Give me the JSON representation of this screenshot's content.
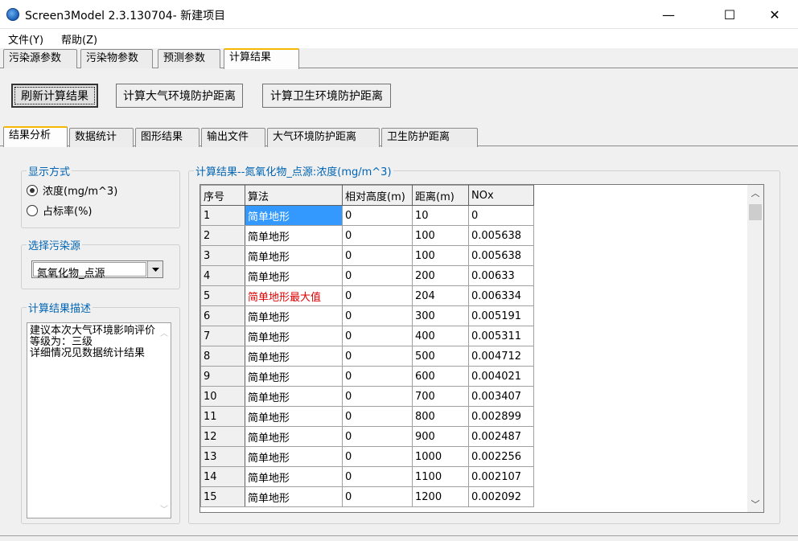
{
  "window": {
    "title": "Screen3Model 2.3.130704- 新建项目",
    "minimize": "—",
    "maximize": "☐",
    "close": "✕"
  },
  "menu": [
    "文件(Y)",
    "帮助(Z)"
  ],
  "main_tabs": [
    "污染源参数",
    "污染物参数",
    "预测参数",
    "计算结果"
  ],
  "main_tab_active": 3,
  "buttons": {
    "refresh": "刷新计算结果",
    "calc_air": "计算大气环境防护距离",
    "calc_health": "计算卫生环境防护距离"
  },
  "sub_tabs": [
    "结果分析",
    "数据统计",
    "图形结果",
    "输出文件",
    "大气环境防护距离",
    "卫生防护距离"
  ],
  "sub_tab_active": 0,
  "display_mode": {
    "label": "显示方式",
    "options": [
      "浓度(mg/m^3)",
      "占标率(%)"
    ],
    "selected": 0
  },
  "source_select": {
    "label": "选择污染源",
    "value": "氮氧化物_点源"
  },
  "description": {
    "label": "计算结果描述",
    "text": "建议本次大气环境影响评价等级为：三级\n详细情况见数据统计结果"
  },
  "results": {
    "label": "计算结果--氮氧化物_点源:浓度(mg/m^3)",
    "columns": [
      "序号",
      "算法",
      "相对高度(m)",
      "距离(m)",
      "NOx"
    ],
    "rows": [
      [
        "1",
        "简单地形",
        "0",
        "10",
        "0"
      ],
      [
        "2",
        "简单地形",
        "0",
        "100",
        "0.005638"
      ],
      [
        "3",
        "简单地形",
        "0",
        "100",
        "0.005638"
      ],
      [
        "4",
        "简单地形",
        "0",
        "200",
        "0.00633"
      ],
      [
        "5",
        "简单地形最大值",
        "0",
        "204",
        "0.006334"
      ],
      [
        "6",
        "简单地形",
        "0",
        "300",
        "0.005191"
      ],
      [
        "7",
        "简单地形",
        "0",
        "400",
        "0.005311"
      ],
      [
        "8",
        "简单地形",
        "0",
        "500",
        "0.004712"
      ],
      [
        "9",
        "简单地形",
        "0",
        "600",
        "0.004021"
      ],
      [
        "10",
        "简单地形",
        "0",
        "700",
        "0.003407"
      ],
      [
        "11",
        "简单地形",
        "0",
        "800",
        "0.002899"
      ],
      [
        "12",
        "简单地形",
        "0",
        "900",
        "0.002487"
      ],
      [
        "13",
        "简单地形",
        "0",
        "1000",
        "0.002256"
      ],
      [
        "14",
        "简单地形",
        "0",
        "1100",
        "0.002107"
      ],
      [
        "15",
        "简单地形",
        "0",
        "1200",
        "0.002092"
      ]
    ],
    "selected_row": 0,
    "highlight_row": 4
  },
  "colors": {
    "selection": "#3399ff",
    "max_value_text": "#e00000",
    "group_label": "#0064b4",
    "active_tab_accent": "#f5b700"
  }
}
